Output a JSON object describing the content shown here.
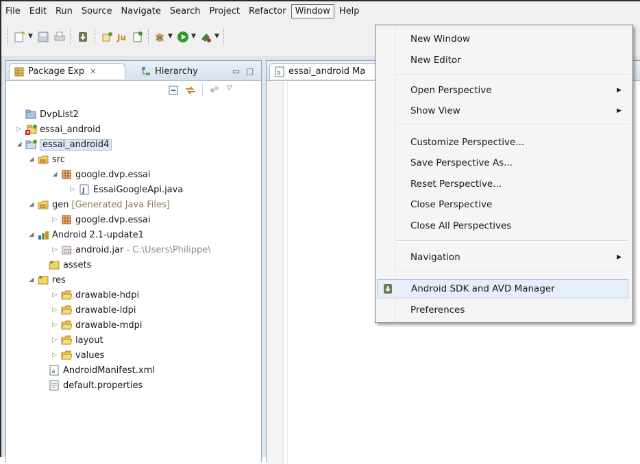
{
  "menubar": {
    "items": [
      "File",
      "Edit",
      "Run",
      "Source",
      "Navigate",
      "Search",
      "Project",
      "Refactor",
      "Window",
      "Help"
    ]
  },
  "package_view": {
    "tab_label": "Package Exp",
    "tab2_label": "Hierarchy",
    "editor_tab_label": "essai_android Ma",
    "tree": [
      {
        "label": "DvpList2",
        "icon": "closed-project-icon",
        "twisty": ""
      },
      {
        "label": "essai_android",
        "icon": "android-project-error-icon",
        "twisty": "▷"
      },
      {
        "label": "essai_android4",
        "icon": "android-project-icon",
        "twisty": "◢"
      },
      {
        "label": "src",
        "icon": "source-folder-icon",
        "twisty": "◢"
      },
      {
        "label": "google.dvp.essai",
        "icon": "package-icon",
        "twisty": "◢"
      },
      {
        "label": "EssaiGoogleApi.java",
        "icon": "java-file-icon",
        "twisty": "▷"
      },
      {
        "label": "gen",
        "decoration": "[Generated Java Files]",
        "icon": "gen-folder-icon",
        "twisty": "◢"
      },
      {
        "label": "google.dvp.essai",
        "icon": "package-icon",
        "twisty": "▷"
      },
      {
        "label": "Android 2.1-update1",
        "icon": "library-icon",
        "twisty": "◢"
      },
      {
        "label": "android.jar",
        "decoration": "- C:\\Users\\Philippe\\",
        "icon": "jar-icon",
        "twisty": "▷"
      },
      {
        "label": "assets",
        "icon": "folder-icon",
        "twisty": ""
      },
      {
        "label": "res",
        "icon": "folder-icon",
        "twisty": "◢"
      },
      {
        "label": "drawable-hdpi",
        "icon": "folder-open-icon",
        "twisty": "▷"
      },
      {
        "label": "drawable-ldpi",
        "icon": "folder-open-icon",
        "twisty": "▷"
      },
      {
        "label": "drawable-mdpi",
        "icon": "folder-open-icon",
        "twisty": "▷"
      },
      {
        "label": "layout",
        "icon": "folder-open-icon",
        "twisty": "▷"
      },
      {
        "label": "values",
        "icon": "folder-open-icon",
        "twisty": "▷"
      },
      {
        "label": "AndroidManifest.xml",
        "icon": "xml-file-icon",
        "twisty": ""
      },
      {
        "label": "default.properties",
        "icon": "text-file-icon",
        "twisty": ""
      }
    ]
  },
  "window_menu": {
    "items": [
      {
        "label": "New Window",
        "submenu": false
      },
      {
        "label": "New Editor",
        "submenu": false
      },
      {
        "label": "Open Perspective",
        "submenu": true
      },
      {
        "label": "Show View",
        "submenu": true
      },
      {
        "label": "Customize Perspective...",
        "submenu": false
      },
      {
        "label": "Save Perspective As...",
        "submenu": false
      },
      {
        "label": "Reset Perspective...",
        "submenu": false
      },
      {
        "label": "Close Perspective",
        "submenu": false
      },
      {
        "label": "Close All Perspectives",
        "submenu": false
      },
      {
        "label": "Navigation",
        "submenu": true
      },
      {
        "label": "Android SDK and AVD Manager",
        "submenu": false
      },
      {
        "label": "Preferences",
        "submenu": false
      }
    ],
    "arrow_glyph": "▶"
  }
}
